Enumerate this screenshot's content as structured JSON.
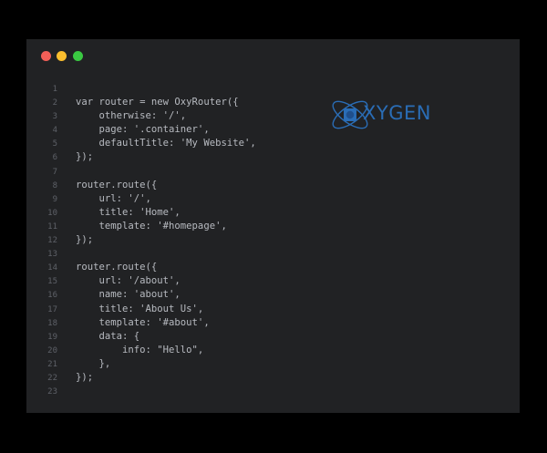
{
  "window": {
    "controls": {
      "close_color": "#f25f58",
      "minimize_color": "#fbbe2e",
      "maximize_color": "#3ac942"
    }
  },
  "editor": {
    "lines": [
      {
        "num": "1",
        "code": ""
      },
      {
        "num": "2",
        "code": "var router = new OxyRouter({"
      },
      {
        "num": "3",
        "code": "    otherwise: '/',"
      },
      {
        "num": "4",
        "code": "    page: '.container',"
      },
      {
        "num": "5",
        "code": "    defaultTitle: 'My Website',"
      },
      {
        "num": "6",
        "code": "});"
      },
      {
        "num": "7",
        "code": ""
      },
      {
        "num": "8",
        "code": "router.route({"
      },
      {
        "num": "9",
        "code": "    url: '/',"
      },
      {
        "num": "10",
        "code": "    title: 'Home',"
      },
      {
        "num": "11",
        "code": "    template: '#homepage',"
      },
      {
        "num": "12",
        "code": "});"
      },
      {
        "num": "13",
        "code": ""
      },
      {
        "num": "14",
        "code": "router.route({"
      },
      {
        "num": "15",
        "code": "    url: '/about',"
      },
      {
        "num": "16",
        "code": "    name: 'about',"
      },
      {
        "num": "17",
        "code": "    title: 'About Us',"
      },
      {
        "num": "18",
        "code": "    template: '#about',"
      },
      {
        "num": "19",
        "code": "    data: {"
      },
      {
        "num": "20",
        "code": "        info: \"Hello\","
      },
      {
        "num": "21",
        "code": "    },"
      },
      {
        "num": "22",
        "code": "});"
      },
      {
        "num": "23",
        "code": ""
      }
    ]
  },
  "logo": {
    "text": "XYGEN",
    "icon": "atom-o-icon",
    "color": "#2a6db6"
  }
}
